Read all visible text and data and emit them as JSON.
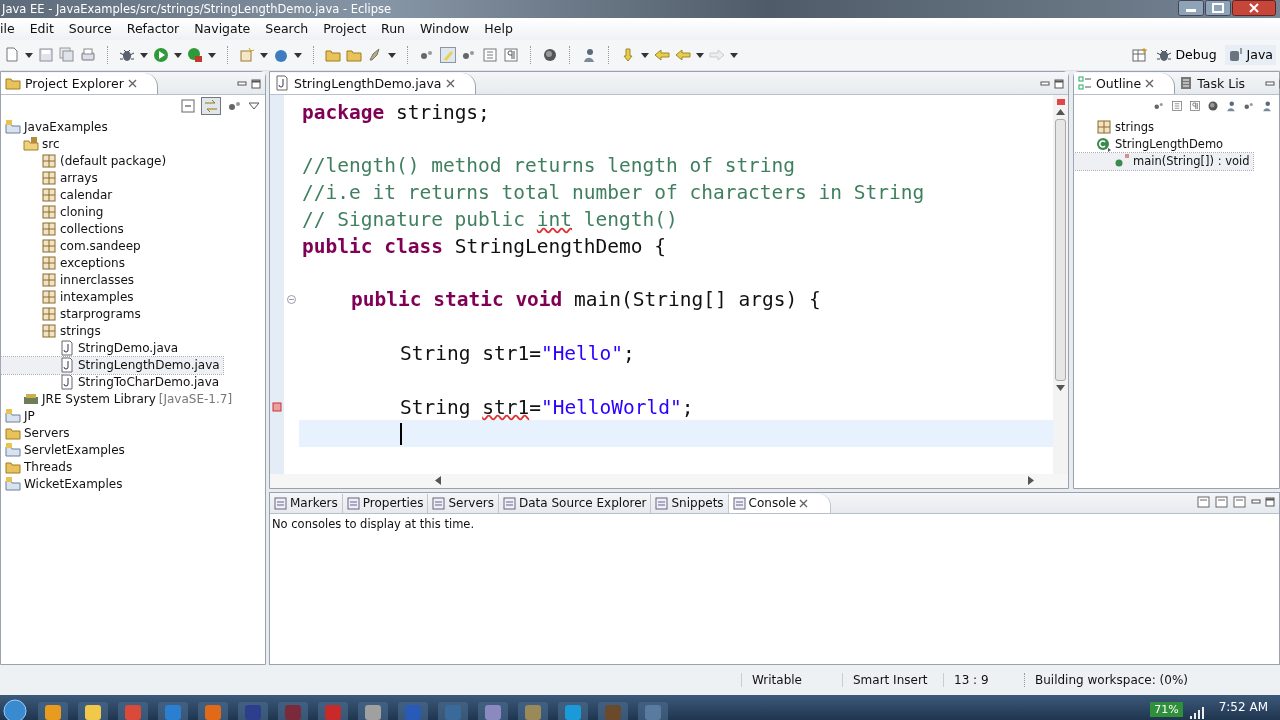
{
  "window": {
    "title": "Java EE - JavaExamples/src/strings/StringLengthDemo.java - Eclipse"
  },
  "menu": [
    "ile",
    "Edit",
    "Source",
    "Refactor",
    "Navigate",
    "Search",
    "Project",
    "Run",
    "Window",
    "Help"
  ],
  "perspectives": [
    {
      "label": "Debug",
      "selected": false
    },
    {
      "label": "Java",
      "selected": true
    }
  ],
  "project_explorer": {
    "title": "Project Explorer",
    "tree": [
      {
        "label": "JavaExamples",
        "kind": "project",
        "selected": false,
        "children": [
          {
            "label": "src",
            "kind": "source",
            "selected": false,
            "children": [
              {
                "label": "(default package)",
                "kind": "package",
                "selected": false
              },
              {
                "label": "arrays",
                "kind": "package",
                "selected": false
              },
              {
                "label": "calendar",
                "kind": "package",
                "selected": false
              },
              {
                "label": "cloning",
                "kind": "package",
                "selected": false
              },
              {
                "label": "collections",
                "kind": "package",
                "selected": false
              },
              {
                "label": "com.sandeep",
                "kind": "package",
                "selected": false
              },
              {
                "label": "exceptions",
                "kind": "package",
                "selected": false
              },
              {
                "label": "innerclasses",
                "kind": "package",
                "selected": false
              },
              {
                "label": "intexamples",
                "kind": "package",
                "selected": false
              },
              {
                "label": "starprograms",
                "kind": "package",
                "selected": false
              },
              {
                "label": "strings",
                "kind": "package",
                "selected": false,
                "children": [
                  {
                    "label": "StringDemo.java",
                    "kind": "file",
                    "selected": false
                  },
                  {
                    "label": "StringLengthDemo.java",
                    "kind": "file",
                    "selected": true
                  },
                  {
                    "label": "StringToCharDemo.java",
                    "kind": "file",
                    "selected": false
                  }
                ]
              }
            ]
          },
          {
            "label": "JRE System Library",
            "detail": "[JavaSE-1.7]",
            "kind": "library",
            "selected": false
          }
        ]
      },
      {
        "label": "JP",
        "kind": "project",
        "selected": false
      },
      {
        "label": "Servers",
        "kind": "folder",
        "selected": false
      },
      {
        "label": "ServletExamples",
        "kind": "project",
        "selected": false
      },
      {
        "label": "Threads",
        "kind": "folder",
        "selected": false
      },
      {
        "label": "WicketExamples",
        "kind": "project",
        "selected": false
      }
    ]
  },
  "editor": {
    "tab": "StringLengthDemo.java",
    "lines": [
      {
        "kind": "code",
        "tokens": [
          {
            "kind": "keyword",
            "text": "package"
          },
          {
            "kind": "text",
            "text": " strings;"
          }
        ]
      },
      {
        "kind": "blank"
      },
      {
        "kind": "code",
        "tokens": [
          {
            "kind": "comment",
            "text": "//length() method returns length of string"
          }
        ]
      },
      {
        "kind": "code",
        "tokens": [
          {
            "kind": "comment",
            "text": "//i.e it returns total number of characters in String"
          }
        ]
      },
      {
        "kind": "code",
        "tokens": [
          {
            "kind": "comment",
            "text": "// Signature public "
          },
          {
            "kind": "flagged-comment",
            "text": "int"
          },
          {
            "kind": "comment",
            "text": " length()"
          }
        ]
      },
      {
        "kind": "code",
        "tokens": [
          {
            "kind": "keyword",
            "text": "public"
          },
          {
            "kind": "keyword",
            "text": " class"
          },
          {
            "kind": "text",
            "text": " StringLengthDemo {"
          }
        ],
        "children": [
          {
            "kind": "blank"
          },
          {
            "kind": "code",
            "fold": true,
            "tokens": [
              {
                "kind": "keyword",
                "text": "public"
              },
              {
                "kind": "keyword",
                "text": " static"
              },
              {
                "kind": "keyword",
                "text": " void"
              },
              {
                "kind": "text",
                "text": " main(String[] args) {"
              }
            ],
            "children": [
              {
                "kind": "blank"
              },
              {
                "kind": "code",
                "tokens": [
                  {
                    "kind": "text",
                    "text": "String str1="
                  },
                  {
                    "kind": "string",
                    "text": "\"Hello\""
                  },
                  {
                    "kind": "text",
                    "text": ";"
                  }
                ]
              },
              {
                "kind": "blank"
              },
              {
                "kind": "code",
                "error": true,
                "tokens": [
                  {
                    "kind": "text",
                    "text": "String "
                  },
                  {
                    "kind": "flagged-text",
                    "text": "str1"
                  },
                  {
                    "kind": "text",
                    "text": "="
                  },
                  {
                    "kind": "string",
                    "text": "\"HelloWorld\""
                  },
                  {
                    "kind": "text",
                    "text": ";"
                  }
                ]
              },
              {
                "kind": "cursor"
              }
            ]
          }
        ]
      }
    ]
  },
  "outline": {
    "tabs": [
      {
        "label": "Outline",
        "selected": true
      },
      {
        "label": "Task Lis",
        "selected": false
      }
    ],
    "tree": [
      {
        "label": "strings",
        "kind": "package",
        "selected": false
      },
      {
        "label": "StringLengthDemo",
        "kind": "class",
        "selected": false,
        "children": [
          {
            "label": "main(String[]) : void",
            "kind": "method",
            "selected": true
          }
        ]
      }
    ]
  },
  "bottom": {
    "tabs": [
      {
        "label": "Markers",
        "selected": false
      },
      {
        "label": "Properties",
        "selected": false
      },
      {
        "label": "Servers",
        "selected": false
      },
      {
        "label": "Data Source Explorer",
        "selected": false
      },
      {
        "label": "Snippets",
        "selected": false
      },
      {
        "label": "Console",
        "selected": true
      }
    ],
    "message": "No consoles to display at this time."
  },
  "status_bar": [
    "Writable",
    "Smart Insert",
    "13 : 9",
    "Building workspace: (0%)"
  ],
  "taskbar": {
    "battery": "71%",
    "clock": "7:52 AM"
  }
}
